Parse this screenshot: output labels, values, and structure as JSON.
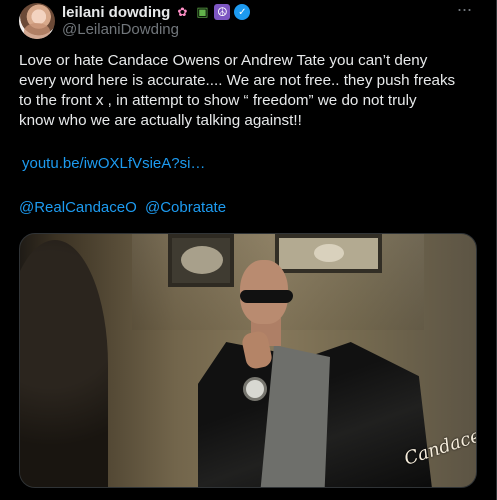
{
  "post": {
    "author": {
      "display_name": "leilani dowding",
      "handle": "@LeilaniDowding",
      "badges": [
        "sakura-icon",
        "tractor-icon",
        "peace-icon",
        "verified-icon"
      ],
      "accent_colors": {
        "verified": "#1d9bf0",
        "muted": "#71767b"
      }
    },
    "menu_icon": "more-icon",
    "text_lines": [
      "Love or hate Candace Owens  or Andrew Tate you can’t deny",
      "every word here is accurate.... We are not free.. they push freaks",
      "to the front x , in attempt to show “ freedom”  we do not truly",
      "know who we are actually talking  against!!"
    ],
    "link": "youtu.be/iwOXLfVsieA?si…",
    "mentions": [
      "@RealCandaceO",
      "@Cobratate"
    ],
    "media": {
      "watermark": "Candace"
    }
  }
}
